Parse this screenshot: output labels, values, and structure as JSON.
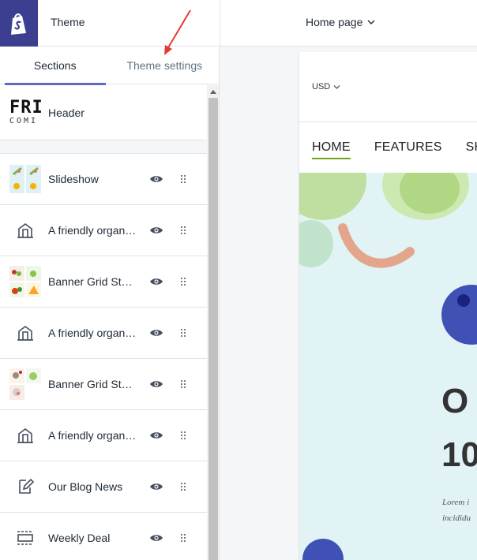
{
  "app": {
    "title": "Theme",
    "page_select": "Home page"
  },
  "tabs": [
    {
      "label": "Sections",
      "active": true
    },
    {
      "label": "Theme settings",
      "active": false
    }
  ],
  "header_section": {
    "label": "Header",
    "thumb_text_top": "FRI",
    "thumb_text_bottom": "COMI"
  },
  "sections": [
    {
      "label": "Slideshow",
      "thumb": "image"
    },
    {
      "label": "A friendly organ…",
      "thumb": "text-icon"
    },
    {
      "label": "Banner Grid Styl…",
      "thumb": "image"
    },
    {
      "label": "A friendly organ…",
      "thumb": "text-icon"
    },
    {
      "label": "Banner Grid Styl…",
      "thumb": "image"
    },
    {
      "label": "A friendly organ…",
      "thumb": "text-icon"
    },
    {
      "label": "Our Blog News",
      "thumb": "blog-icon"
    },
    {
      "label": "Weekly Deal",
      "thumb": "deal-icon"
    }
  ],
  "preview": {
    "currency": "USD",
    "nav": [
      "HOME",
      "FEATURES",
      "SH"
    ],
    "hero_big_1": "O",
    "hero_big_2": "10",
    "hero_text_1": "Lorem i",
    "hero_text_2": "incididu"
  },
  "colors": {
    "brand": "#3c3f8f",
    "tab_indicator": "#5c6ac4",
    "nav_active": "#6fa515",
    "annotation_arrow": "#e53935"
  }
}
